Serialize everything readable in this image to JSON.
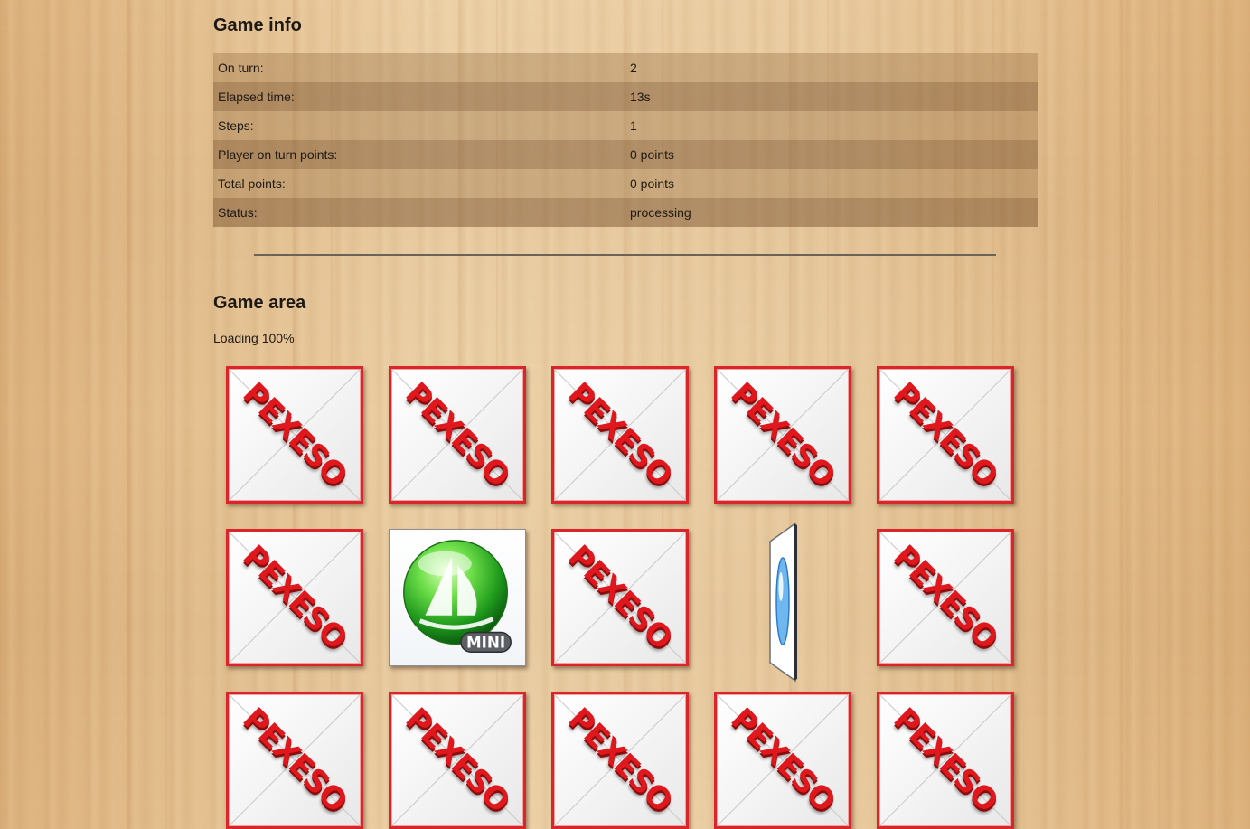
{
  "game_info": {
    "heading": "Game info",
    "rows": [
      {
        "label": "On turn:",
        "value": "2"
      },
      {
        "label": "Elapsed time:",
        "value": "13s"
      },
      {
        "label": "Steps:",
        "value": "1"
      },
      {
        "label": "Player on turn points:",
        "value": "0 points"
      },
      {
        "label": "Total points:",
        "value": "0 points"
      },
      {
        "label": "Status:",
        "value": "processing"
      }
    ]
  },
  "game_area": {
    "heading": "Game area",
    "loading_text": "Loading 100%",
    "card_back_text": "PEXESO",
    "revealed_card_badge": "MINI",
    "cards": [
      {
        "state": "face-down"
      },
      {
        "state": "face-down"
      },
      {
        "state": "face-down"
      },
      {
        "state": "face-down"
      },
      {
        "state": "face-down"
      },
      {
        "state": "face-down"
      },
      {
        "state": "face-up",
        "icon": "green-sphere-sailboat-mini-icon"
      },
      {
        "state": "face-down"
      },
      {
        "state": "flipping"
      },
      {
        "state": "face-down"
      },
      {
        "state": "face-down"
      },
      {
        "state": "face-down"
      },
      {
        "state": "face-down"
      },
      {
        "state": "face-down"
      },
      {
        "state": "face-down"
      }
    ]
  }
}
